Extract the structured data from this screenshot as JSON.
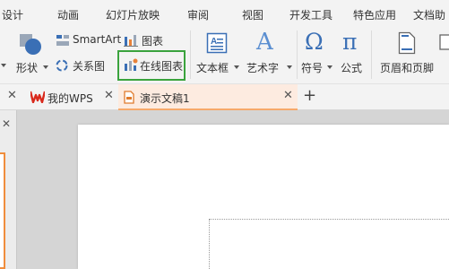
{
  "menu": {
    "design": "设计",
    "animation": "动画",
    "slideshow": "幻灯片放映",
    "review": "审阅",
    "view": "视图",
    "developer": "开发工具",
    "special": "特色应用",
    "docs": "文档助"
  },
  "ribbon": {
    "smartart_label": "SmartArt",
    "chart_label": "图表",
    "shape_label": "形状",
    "relation_label": "关系图",
    "online_chart_label": "在线图表",
    "textbox_label": "文本框",
    "wordart_label": "艺术字",
    "symbol_label": "符号",
    "formula_label": "公式",
    "header_footer_label": "页眉和页脚"
  },
  "tabs": [
    {
      "label": "我的WPS"
    },
    {
      "label": "演示文稿1"
    }
  ],
  "colors": {
    "chart_highlight": "#3aa33d",
    "wps_red": "#d9291c",
    "accent_blue": "#3a6fb5",
    "active_tab_border": "#f6a96b"
  }
}
